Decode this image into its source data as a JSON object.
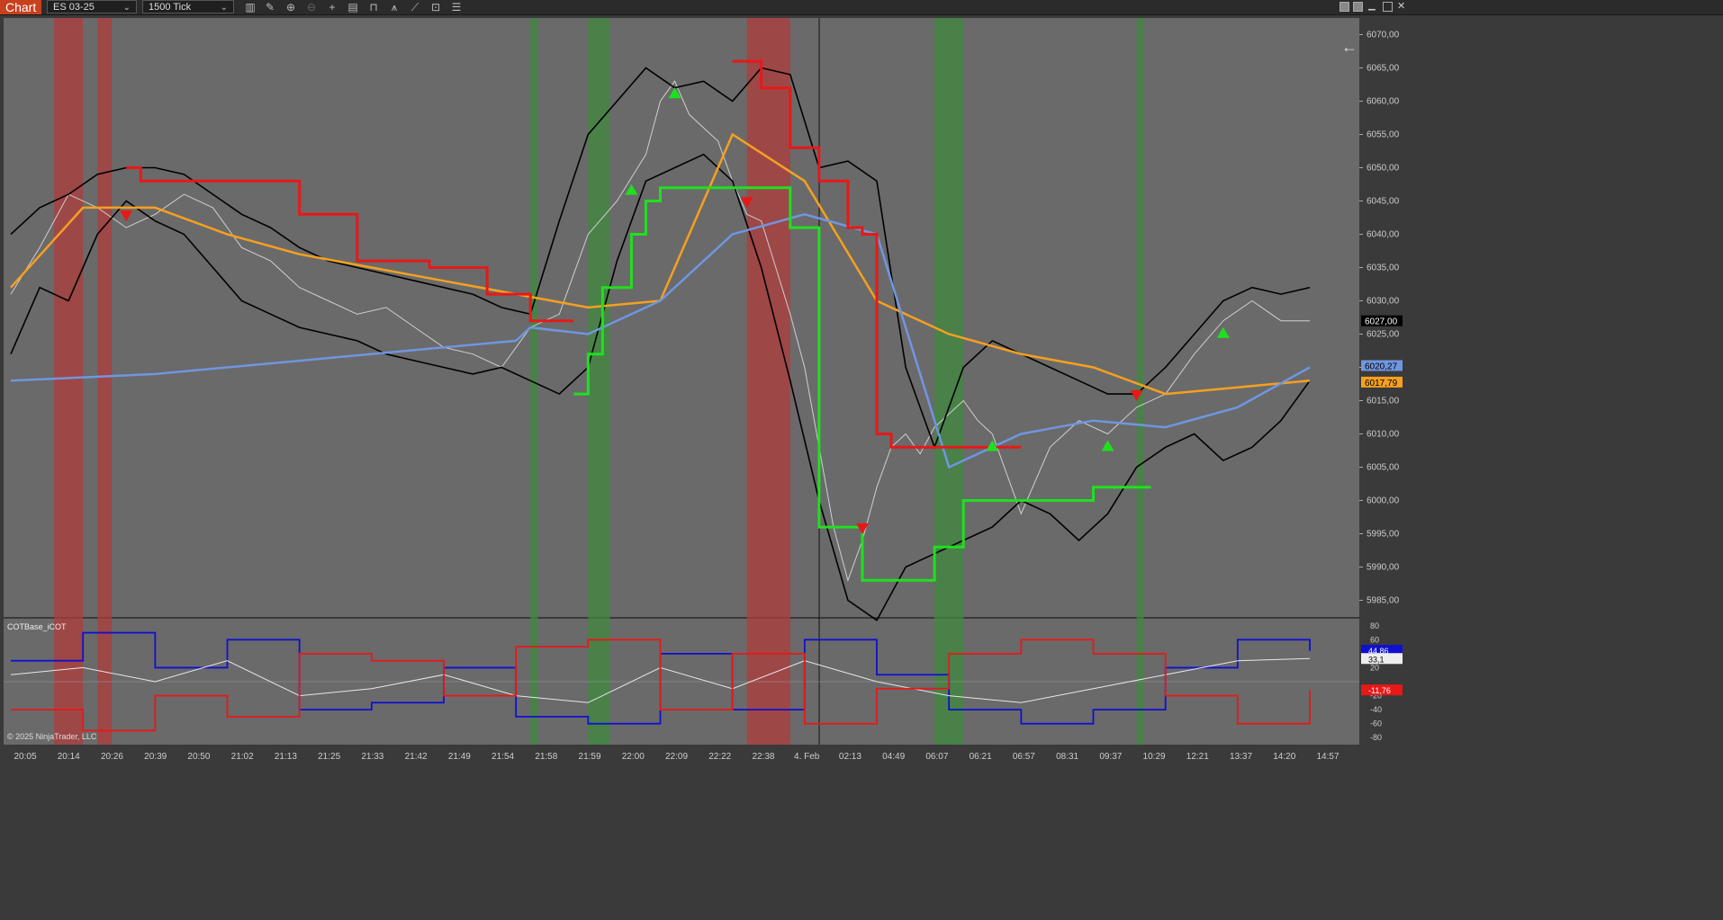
{
  "toolbar": {
    "tab_label": "Chart",
    "instrument": "ES 03-25",
    "bar_type": "1500 Tick",
    "icons": [
      "bars-icon",
      "pencil-icon",
      "zoom-in-icon",
      "zoom-out-icon",
      "crosshair-icon",
      "properties-icon",
      "strategies-icon",
      "indicators-icon",
      "drawing-tools-icon",
      "screenshot-icon",
      "list-icon"
    ]
  },
  "colors": {
    "price_bg": "#6a6a6a",
    "indicator_bg": "#6a6a6a",
    "red_zone": "#b03c3c",
    "green_zone": "#3f8a3f",
    "upper_band": "#000000",
    "supertrend_up": "#1fe01f",
    "supertrend_down": "#e81818",
    "orange_ma": "#f5a020",
    "blue_ma": "#6f96e0",
    "marker_yellow": "#f0c010",
    "marker_blue": "#1010d0"
  },
  "chart_data": [
    {
      "type": "line",
      "title": "",
      "price_scale": {
        "ticks": [
          "6070,00",
          "6065,00",
          "6060,00",
          "6055,00",
          "6050,00",
          "6045,00",
          "6040,00",
          "6035,00",
          "6030,00",
          "6025,00",
          "6020,00",
          "6015,00",
          "6010,00",
          "6005,00",
          "6000,00",
          "5995,00",
          "5990,00",
          "5985,00"
        ],
        "ylim": [
          5982.5,
          6072.5
        ],
        "last_price": "6027,00",
        "blue_ma_value": "6020,27",
        "orange_ma_value": "6017,79"
      },
      "time_labels": [
        "20:05",
        "20:14",
        "20:26",
        "20:39",
        "20:50",
        "21:02",
        "21:13",
        "21:25",
        "21:33",
        "21:42",
        "21:49",
        "21:54",
        "21:58",
        "21:59",
        "22:00",
        "22:09",
        "22:22",
        "22:38",
        "4. Feb",
        "02:13",
        "04:49",
        "06:07",
        "06:21",
        "06:57",
        "08:31",
        "09:37",
        "10:29",
        "12:21",
        "13:37",
        "14:20",
        "14:57"
      ],
      "x_domain": [
        0,
        180
      ],
      "series": [
        {
          "role": "close",
          "x": [
            0,
            4,
            8,
            12,
            16,
            20,
            24,
            28,
            32,
            36,
            40,
            44,
            48,
            52,
            56,
            60,
            64,
            68,
            70,
            72,
            76,
            80,
            84,
            88,
            90,
            92,
            94,
            96,
            98,
            100,
            102,
            104,
            106,
            108,
            110,
            112,
            114,
            116,
            118,
            120,
            122,
            124,
            126,
            128,
            130,
            132,
            134,
            136,
            138,
            140,
            144,
            148,
            152,
            156,
            160,
            164,
            168,
            172,
            176,
            180
          ],
          "y": [
            6031,
            6038,
            6046,
            6044,
            6041,
            6043,
            6046,
            6044,
            6038,
            6036,
            6032,
            6030,
            6028,
            6029,
            6026,
            6023,
            6022,
            6020,
            6023,
            6026,
            6028,
            6040,
            6045,
            6052,
            6060,
            6063,
            6058,
            6056,
            6054,
            6048,
            6043,
            6042,
            6035,
            6028,
            6020,
            6008,
            5996,
            5988,
            5994,
            6002,
            6008,
            6010,
            6007,
            6011,
            6013,
            6015,
            6012,
            6010,
            6004,
            5998,
            6008,
            6012,
            6010,
            6014,
            6016,
            6022,
            6027,
            6030,
            6027,
            6027
          ]
        },
        {
          "role": "upper_band",
          "x": [
            0,
            4,
            8,
            12,
            16,
            20,
            24,
            28,
            32,
            36,
            40,
            44,
            48,
            52,
            56,
            60,
            64,
            68,
            72,
            76,
            80,
            84,
            88,
            92,
            96,
            100,
            104,
            108,
            112,
            116,
            120,
            124,
            128,
            132,
            136,
            140,
            144,
            148,
            152,
            156,
            160,
            164,
            168,
            172,
            176,
            180
          ],
          "y": [
            6040,
            6044,
            6046,
            6049,
            6050,
            6050,
            6049,
            6046,
            6043,
            6041,
            6038,
            6036,
            6035,
            6034,
            6033,
            6032,
            6031,
            6029,
            6028,
            6042,
            6055,
            6060,
            6065,
            6062,
            6063,
            6060,
            6065,
            6064,
            6050,
            6051,
            6048,
            6020,
            6008,
            6020,
            6024,
            6022,
            6020,
            6018,
            6016,
            6016,
            6020,
            6025,
            6030,
            6032,
            6031,
            6032
          ]
        },
        {
          "role": "lower_band",
          "x": [
            0,
            4,
            8,
            12,
            16,
            20,
            24,
            28,
            32,
            36,
            40,
            44,
            48,
            52,
            56,
            60,
            64,
            68,
            72,
            76,
            80,
            84,
            88,
            92,
            96,
            100,
            104,
            108,
            112,
            116,
            120,
            124,
            128,
            132,
            136,
            140,
            144,
            148,
            152,
            156,
            160,
            164,
            168,
            172,
            176,
            180
          ],
          "y": [
            6022,
            6032,
            6030,
            6040,
            6045,
            6042,
            6040,
            6035,
            6030,
            6028,
            6026,
            6025,
            6024,
            6022,
            6021,
            6020,
            6019,
            6020,
            6018,
            6016,
            6020,
            6036,
            6048,
            6050,
            6052,
            6048,
            6035,
            6018,
            6000,
            5985,
            5982,
            5990,
            5992,
            5994,
            5996,
            6000,
            5998,
            5994,
            5998,
            6005,
            6008,
            6010,
            6006,
            6008,
            6012,
            6018
          ]
        },
        {
          "role": "orange_ma",
          "x": [
            0,
            10,
            20,
            30,
            40,
            50,
            60,
            70,
            80,
            90,
            100,
            110,
            120,
            130,
            140,
            150,
            160,
            170,
            180
          ],
          "y": [
            6032,
            6044,
            6044,
            6040,
            6037,
            6035,
            6033,
            6031,
            6029,
            6030,
            6055,
            6048,
            6030,
            6025,
            6022,
            6020,
            6016,
            6017,
            6018
          ]
        },
        {
          "role": "blue_ma",
          "x": [
            0,
            20,
            40,
            60,
            70,
            72,
            80,
            90,
            100,
            110,
            120,
            130,
            140,
            150,
            160,
            170,
            180
          ],
          "y": [
            6018,
            6019,
            6021,
            6023,
            6024,
            6026,
            6025,
            6030,
            6040,
            6043,
            6040,
            6005,
            6010,
            6012,
            6011,
            6014,
            6020
          ]
        },
        {
          "role": "supertrend_down",
          "x": [
            16,
            18,
            18,
            40,
            40,
            48,
            48,
            58,
            58,
            66,
            66,
            72,
            72,
            78,
            78
          ],
          "y": [
            6050,
            6048,
            6048,
            6048,
            6043,
            6043,
            6036,
            6036,
            6035,
            6035,
            6031,
            6031,
            6027,
            6027,
            6027
          ]
        },
        {
          "role": "supertrend_up",
          "x": [
            78,
            80,
            82,
            86,
            88,
            90,
            98,
            104,
            108,
            112,
            118,
            124,
            128,
            132,
            140,
            146,
            150,
            154,
            158
          ],
          "y": [
            6016,
            6022,
            6032,
            6040,
            6045,
            6047,
            6047,
            6047,
            6041,
            5996,
            5988,
            5988,
            5993,
            6000,
            6000,
            6000,
            6002,
            6002,
            6002
          ]
        },
        {
          "role": "supertrend_down_2",
          "x": [
            100,
            104,
            108,
            112,
            116,
            118,
            120,
            122,
            124,
            128,
            130,
            132,
            136,
            140
          ],
          "y": [
            6066,
            6062,
            6053,
            6048,
            6041,
            6040,
            6010,
            6008,
            6008,
            6008,
            6008,
            6008,
            6008,
            6008
          ]
        }
      ],
      "buy_markers_x": [
        86,
        92,
        136,
        152,
        168
      ],
      "sell_markers_x": [
        16,
        102,
        118,
        156
      ],
      "red_zones_x": [
        [
          6,
          10
        ],
        [
          12,
          14
        ],
        [
          102,
          108
        ]
      ],
      "green_zones_x": [
        [
          72,
          73
        ],
        [
          80,
          83
        ],
        [
          128,
          132
        ],
        [
          156,
          157
        ]
      ]
    },
    {
      "type": "line",
      "title": "COTBase_iCOT",
      "ylim": [
        -90,
        90
      ],
      "ticks": [
        "80",
        "60",
        "40",
        "20",
        "-20",
        "-40",
        "-60",
        "-80"
      ],
      "blue_value": "44,86",
      "white_value": "33,1",
      "red_value": "-11,76",
      "series": [
        {
          "role": "blue",
          "x": [
            0,
            10,
            20,
            30,
            40,
            50,
            60,
            70,
            80,
            90,
            100,
            110,
            120,
            130,
            140,
            150,
            160,
            170,
            180
          ],
          "y": [
            30,
            70,
            20,
            60,
            -40,
            -30,
            20,
            -50,
            -60,
            40,
            -40,
            60,
            10,
            -40,
            -60,
            -40,
            20,
            60,
            44
          ]
        },
        {
          "role": "white",
          "x": [
            0,
            10,
            20,
            30,
            40,
            50,
            60,
            70,
            80,
            90,
            100,
            110,
            120,
            130,
            140,
            150,
            160,
            170,
            180
          ],
          "y": [
            10,
            20,
            0,
            30,
            -20,
            -10,
            10,
            -20,
            -30,
            20,
            -10,
            30,
            0,
            -20,
            -30,
            -10,
            10,
            30,
            33
          ]
        },
        {
          "role": "red",
          "x": [
            0,
            10,
            20,
            30,
            40,
            50,
            60,
            70,
            80,
            90,
            100,
            110,
            120,
            130,
            140,
            150,
            160,
            170,
            180
          ],
          "y": [
            -40,
            -70,
            -20,
            -50,
            40,
            30,
            -20,
            50,
            60,
            -40,
            40,
            -60,
            -10,
            40,
            60,
            40,
            -20,
            -60,
            -12
          ]
        }
      ]
    }
  ],
  "copyright": "© 2025 NinjaTrader, LLC"
}
